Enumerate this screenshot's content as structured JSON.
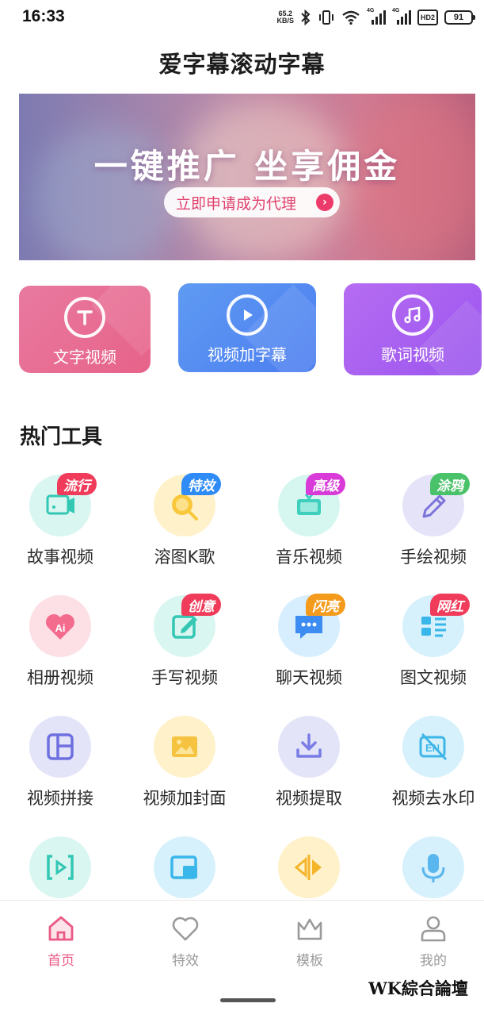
{
  "status": {
    "time": "16:33",
    "net_speed_value": "65.2",
    "net_speed_unit": "KB/S",
    "sim1": "4G",
    "sim2": "4G",
    "hd": "HD",
    "hd_num": "2",
    "battery": "91"
  },
  "header": {
    "title": "爱字幕滚动字幕"
  },
  "banner": {
    "headline": "一键推广 坐享佣金",
    "cta": "立即申请成为代理",
    "cta_arrow": "›"
  },
  "quick_actions": [
    {
      "label": "文字视频",
      "icon": "text-t-icon"
    },
    {
      "label": "视频加字幕",
      "icon": "play-icon"
    },
    {
      "label": "歌词视频",
      "icon": "music-note-icon"
    }
  ],
  "tools_section": {
    "title": "热门工具",
    "items": [
      {
        "label": "故事视频",
        "badge": "流行",
        "badge_color": "#f03c5a",
        "icon": "story-video-icon",
        "bg": "#d9f6f1"
      },
      {
        "label": "溶图K歌",
        "badge": "特效",
        "badge_color": "#2f8cf6",
        "icon": "karaoke-icon",
        "bg": "#fff1c9"
      },
      {
        "label": "音乐视频",
        "badge": "高级",
        "badge_color": "#d83bd8",
        "icon": "music-video-icon",
        "bg": "#d6f7f0"
      },
      {
        "label": "手绘视频",
        "badge": "涂鸦",
        "badge_color": "#49c26a",
        "icon": "pen-draw-icon",
        "bg": "#e5e3f8"
      },
      {
        "label": "相册视频",
        "badge": "",
        "badge_color": "",
        "icon": "album-ai-icon",
        "bg": "#fde0e6"
      },
      {
        "label": "手写视频",
        "badge": "创意",
        "badge_color": "#f03c5a",
        "icon": "handwrite-icon",
        "bg": "#d9f6f1"
      },
      {
        "label": "聊天视频",
        "badge": "闪亮",
        "badge_color": "#f59b1c",
        "icon": "chat-bubble-icon",
        "bg": "#d6eefd"
      },
      {
        "label": "图文视频",
        "badge": "网红",
        "badge_color": "#f03c5a",
        "icon": "image-text-icon",
        "bg": "#d6f1fb"
      },
      {
        "label": "视频拼接",
        "badge": "",
        "badge_color": "",
        "icon": "splice-icon",
        "bg": "#e3e4f8"
      },
      {
        "label": "视频加封面",
        "badge": "",
        "badge_color": "",
        "icon": "cover-image-icon",
        "bg": "#fff1c9"
      },
      {
        "label": "视频提取",
        "badge": "",
        "badge_color": "",
        "icon": "download-icon",
        "bg": "#e3e4f8"
      },
      {
        "label": "视频去水印",
        "badge": "",
        "badge_color": "",
        "icon": "remove-watermark-icon",
        "bg": "#d6f1fb"
      },
      {
        "label": "",
        "badge": "",
        "badge_color": "",
        "icon": "video-frame-icon",
        "bg": "#d9f6f1"
      },
      {
        "label": "",
        "badge": "",
        "badge_color": "",
        "icon": "picture-in-picture-icon",
        "bg": "#d6f1fb"
      },
      {
        "label": "",
        "badge": "",
        "badge_color": "",
        "icon": "mirror-flip-icon",
        "bg": "#fff1c9"
      },
      {
        "label": "",
        "badge": "",
        "badge_color": "",
        "icon": "microphone-icon",
        "bg": "#d6f1fb"
      }
    ]
  },
  "bottom_nav": [
    {
      "label": "首页",
      "icon": "home-icon",
      "active": true
    },
    {
      "label": "特效",
      "icon": "heart-icon",
      "active": false
    },
    {
      "label": "模板",
      "icon": "crown-icon",
      "active": false
    },
    {
      "label": "我的",
      "icon": "user-icon",
      "active": false
    }
  ],
  "watermark": "WK綜合論壇",
  "colors": {
    "accent": "#ea5a85",
    "nav_inactive": "#9a9a9a"
  }
}
